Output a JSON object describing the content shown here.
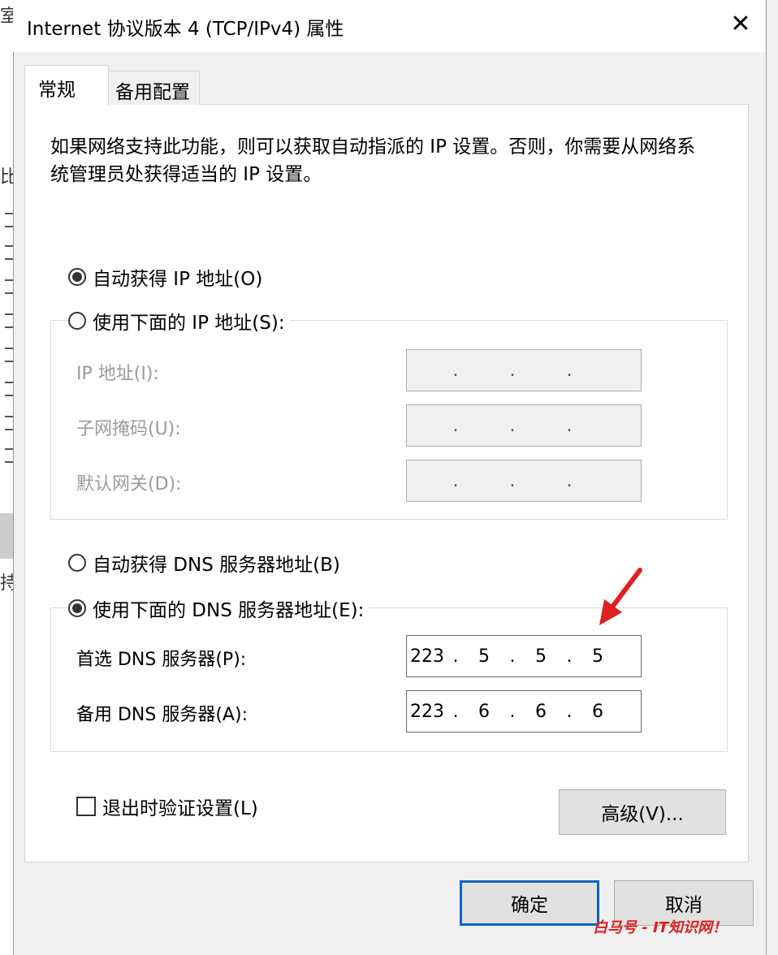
{
  "background_window": {
    "chars": [
      "室",
      "比",
      "持"
    ]
  },
  "dialog": {
    "title": "Internet 协议版本 4 (TCP/IPv4) 属性",
    "close_glyph": "✕",
    "tabs": [
      {
        "label": "常规",
        "active": true
      },
      {
        "label": "备用配置",
        "active": false
      }
    ],
    "description": "如果网络支持此功能，则可以获取自动指派的 IP 设置。否则，你需要从网络系统管理员处获得适当的 IP 设置。",
    "ip_section": {
      "auto_label": "自动获得 IP 地址(O)",
      "auto_checked": true,
      "manual_label": "使用下面的 IP 地址(S):",
      "manual_checked": false,
      "fields": [
        {
          "label": "IP 地址(I):",
          "octets": [
            "",
            "",
            "",
            ""
          ]
        },
        {
          "label": "子网掩码(U):",
          "octets": [
            "",
            "",
            "",
            ""
          ]
        },
        {
          "label": "默认网关(D):",
          "octets": [
            "",
            "",
            "",
            ""
          ]
        }
      ]
    },
    "dns_section": {
      "auto_label": "自动获得 DNS 服务器地址(B)",
      "auto_checked": false,
      "manual_label": "使用下面的 DNS 服务器地址(E):",
      "manual_checked": true,
      "fields": [
        {
          "label": "首选 DNS 服务器(P):",
          "octets": [
            "223",
            "5",
            "5",
            "5"
          ]
        },
        {
          "label": "备用 DNS 服务器(A):",
          "octets": [
            "223",
            "6",
            "6",
            "6"
          ]
        }
      ]
    },
    "validate_label": "退出时验证设置(L)",
    "validate_checked": false,
    "advanced_button": "高级(V)...",
    "ok_button": "确定",
    "cancel_button": "取消",
    "annotation_arrow_color": "#e02020",
    "accent_color": "#0a64c8"
  },
  "watermark": "白马号 - IT知识网！"
}
